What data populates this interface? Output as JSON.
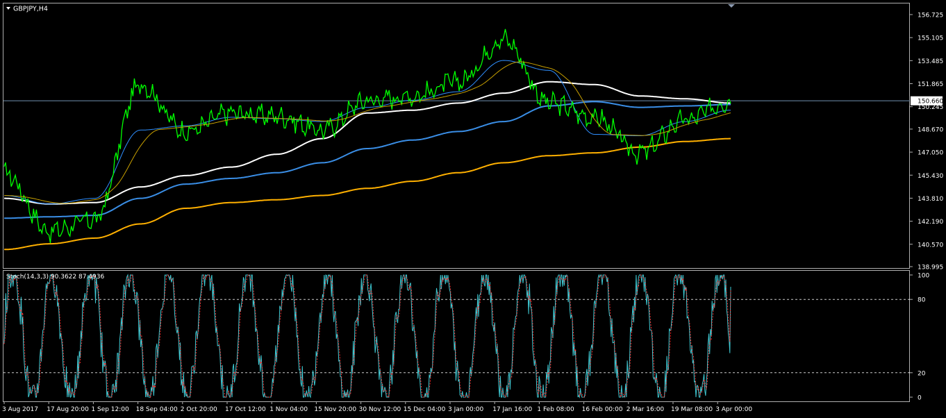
{
  "window": {
    "symbol_label": "GBPJPY,H4"
  },
  "price_panel": {
    "price_axis_labels": [
      "156.725",
      "155.105",
      "153.485",
      "151.865",
      "150.245",
      "148.670",
      "147.050",
      "145.430",
      "143.810",
      "142.190",
      "140.570",
      "138.995"
    ],
    "current_price_label": "150.660"
  },
  "stoch_panel": {
    "indicator_label": "Stoch(14,3,3) 90.3622 87.4936",
    "level_labels": [
      "100",
      "80",
      "20",
      "0"
    ]
  },
  "time_axis": {
    "labels": [
      "3 Aug 2017",
      "17 Aug 20:00",
      "1 Sep 12:00",
      "18 Sep 04:00",
      "2 Oct 20:00",
      "17 Oct 12:00",
      "1 Nov 04:00",
      "15 Nov 20:00",
      "30 Nov 12:00",
      "15 Dec 04:00",
      "3 Jan 00:00",
      "17 Jan 16:00",
      "1 Feb 08:00",
      "16 Feb 00:00",
      "2 Mar 16:00",
      "19 Mar 08:00",
      "3 Apr 00:00"
    ]
  },
  "chart_data": [
    {
      "type": "line",
      "title": "GBPJPY,H4",
      "x": [
        "3 Aug 2017",
        "17 Aug 20:00",
        "1 Sep 12:00",
        "18 Sep 04:00",
        "2 Oct 20:00",
        "17 Oct 12:00",
        "1 Nov 04:00",
        "15 Nov 20:00",
        "30 Nov 12:00",
        "15 Dec 04:00",
        "3 Jan 00:00",
        "17 Jan 16:00",
        "1 Feb 08:00",
        "16 Feb 00:00",
        "2 Mar 16:00",
        "19 Mar 08:00",
        "3 Apr 00:00"
      ],
      "ylim": [
        138.995,
        156.725
      ],
      "current_price": 150.66,
      "series": [
        {
          "values": [
            145.6,
            141.5,
            142.3,
            151.8,
            148.5,
            149.8,
            149.6,
            148.6,
            150.7,
            151.0,
            152.0,
            155.0,
            150.5,
            149.5,
            147.0,
            149.3,
            150.66
          ]
        },
        {
          "values": [
            144.0,
            143.4,
            143.8,
            148.6,
            148.9,
            149.5,
            149.4,
            149.2,
            150.2,
            150.7,
            151.3,
            153.5,
            152.8,
            148.3,
            148.2,
            149.2,
            150.0
          ]
        },
        {
          "values": [
            143.8,
            143.4,
            143.5,
            144.6,
            145.4,
            146.0,
            146.9,
            148.0,
            149.8,
            150.0,
            150.5,
            151.2,
            152.0,
            151.8,
            151.0,
            150.8,
            150.5
          ]
        },
        {
          "values": [
            142.4,
            142.5,
            142.6,
            143.8,
            144.8,
            145.2,
            145.6,
            146.3,
            147.3,
            147.9,
            148.5,
            149.2,
            150.3,
            150.6,
            150.2,
            150.3,
            150.4
          ]
        },
        {
          "values": [
            140.2,
            140.6,
            141.0,
            142.0,
            143.1,
            143.5,
            143.7,
            144.0,
            144.5,
            145.0,
            145.6,
            146.3,
            146.8,
            147.0,
            147.4,
            147.8,
            148.0
          ]
        }
      ]
    },
    {
      "type": "line",
      "title": "Stoch(14,3,3) 90.3622 87.4936",
      "ylim": [
        0,
        100
      ],
      "levels": [
        20,
        80
      ],
      "last_main": 90.3622,
      "last_signal": 87.4936
    }
  ],
  "colors": {
    "background": "#000000",
    "price_line": "#00ff00",
    "ma_fast": "#2f8fff",
    "ma_slow": "#c8a000",
    "ma_white": "#ffffff",
    "ma_blue": "#3a8ee6",
    "ma_gold": "#ffb000",
    "stoch_main": "#3fc9d3",
    "stoch_signal": "#ff3030",
    "axis_text": "#ffffff",
    "grid_line": "#ffffff",
    "current_price_line": "#6f8fb0"
  }
}
